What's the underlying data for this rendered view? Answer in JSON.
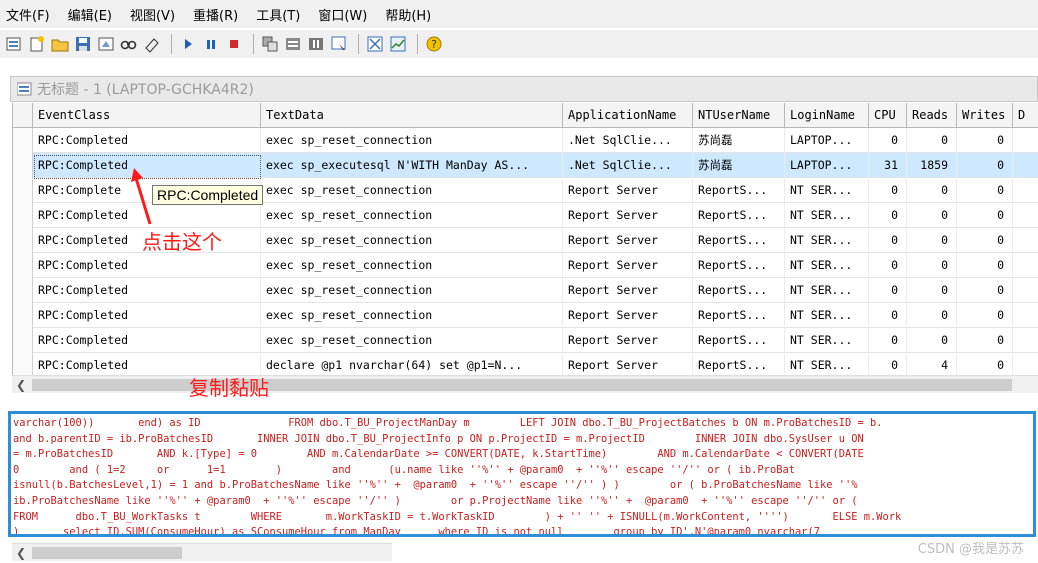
{
  "menu": [
    "文件(F)",
    "编辑(E)",
    "视图(V)",
    "重播(R)",
    "工具(T)",
    "窗口(W)",
    "帮助(H)"
  ],
  "toolbar_icons": [
    "new-trace-icon",
    "new-template-icon",
    "open-icon",
    "save-icon",
    "properties-icon",
    "find-icon",
    "clear-icon",
    "run-icon",
    "pause-icon",
    "stop-icon",
    "step-icon",
    "goto-icon",
    "break-icon",
    "replay-icon",
    "columns-icon",
    "chart-icon",
    "help-icon"
  ],
  "window": {
    "title": "无标题 - 1 (LAPTOP-GCHKA4R2)"
  },
  "grid": {
    "columns": [
      "EventClass",
      "TextData",
      "ApplicationName",
      "NTUserName",
      "LoginName",
      "CPU",
      "Reads",
      "Writes",
      "D"
    ],
    "rows": [
      [
        "RPC:Completed",
        "exec sp_reset_connection",
        ".Net SqlClie...",
        "苏尚磊",
        "LAPTOP...",
        "0",
        "0",
        "0"
      ],
      [
        "RPC:Completed",
        "exec sp_executesql N'WITH ManDay AS...",
        ".Net SqlClie...",
        "苏尚磊",
        "LAPTOP...",
        "31",
        "1859",
        "0"
      ],
      [
        "RPC:Complete",
        "exec sp_reset_connection",
        "Report Server",
        "ReportS...",
        "NT SER...",
        "0",
        "0",
        "0"
      ],
      [
        "RPC:Completed",
        "exec sp_reset_connection",
        "Report Server",
        "ReportS...",
        "NT SER...",
        "0",
        "0",
        "0"
      ],
      [
        "RPC:Completed",
        "exec sp_reset_connection",
        "Report Server",
        "ReportS...",
        "NT SER...",
        "0",
        "0",
        "0"
      ],
      [
        "RPC:Completed",
        "exec sp_reset_connection",
        "Report Server",
        "ReportS...",
        "NT SER...",
        "0",
        "0",
        "0"
      ],
      [
        "RPC:Completed",
        "exec sp_reset_connection",
        "Report Server",
        "ReportS...",
        "NT SER...",
        "0",
        "0",
        "0"
      ],
      [
        "RPC:Completed",
        "exec sp_reset_connection",
        "Report Server",
        "ReportS...",
        "NT SER...",
        "0",
        "0",
        "0"
      ],
      [
        "RPC:Completed",
        "exec sp_reset_connection",
        "Report Server",
        "ReportS...",
        "NT SER...",
        "0",
        "0",
        "0"
      ],
      [
        "RPC:Completed",
        "declare @p1 nvarchar(64)  set @p1=N...",
        "Report Server",
        "ReportS...",
        "NT SER...",
        "0",
        "4",
        "0"
      ]
    ],
    "selected_row": 1
  },
  "tooltip": "RPC:Completed",
  "annotations": {
    "click_this": "点击这个",
    "copy_paste": "复制黏贴"
  },
  "sql_text": [
    "varchar(100))       end) as ID              FROM dbo.T_BU_ProjectManDay m        LEFT JOIN dbo.T_BU_ProjectBatches b ON m.ProBatchesID = b.",
    "and b.parentID = ib.ProBatchesID       INNER JOIN dbo.T_BU_ProjectInfo p ON p.ProjectID = m.ProjectID        INNER JOIN dbo.SysUser u ON",
    "= m.ProBatchesID       AND k.[Type] = 0        AND m.CalendarDate >= CONVERT(DATE, k.StartTime)        AND m.CalendarDate < CONVERT(DATE",
    "0        and ( 1=2     or      1=1        )        and      (u.name like ''%'' + @param0  + ''%'' escape ''/'' or ( ib.ProBat",
    "isnull(b.BatchesLevel,1) = 1 and b.ProBatchesName like ''%'' +  @param0  + ''%'' escape ''/'' ) )        or ( b.ProBatchesName like ''%",
    "ib.ProBatchesName like ''%'' + @param0  + ''%'' escape ''/'' )        or p.ProjectName like ''%'' +  @param0  + ''%'' escape ''/'' or (",
    "FROM      dbo.T_BU_WorkTasks t        WHERE       m.WorkTaskID = t.WorkTaskID        ) + '' '' + ISNULL(m.WorkContent, '''')       ELSE m.Work",
    ")       select ID,SUM(ConsumeHour) as SConsumeHour from ManDay      where ID is not null        group by ID',N'@param0 nvarchar(7"
  ],
  "watermark": "CSDN @我是苏苏",
  "colors": {
    "annotation": "#ff1a1a",
    "selection": "#cde8ff",
    "panel_border": "#2f8fd6",
    "sql_text": "#c81e1e"
  }
}
